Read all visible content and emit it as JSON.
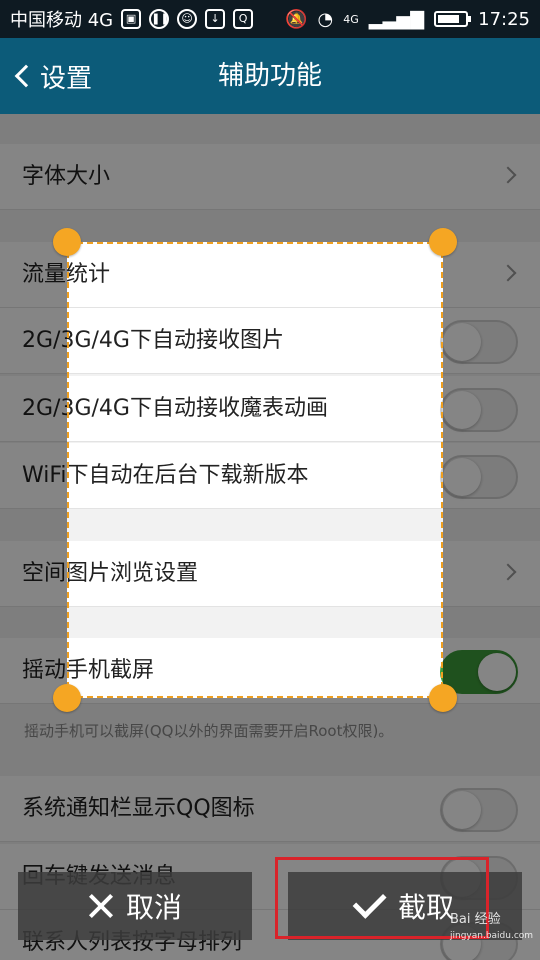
{
  "status_bar": {
    "carrier": "中国移动 4G",
    "signal": "4G",
    "time": "17:25",
    "battery_level": 0.8
  },
  "title_bar": {
    "back_label": "设置",
    "title": "辅助功能"
  },
  "settings": [
    {
      "label": "字体大小",
      "control": "arrow"
    },
    {
      "label": "流量统计",
      "control": "arrow"
    },
    {
      "label": "2G/3G/4G下自动接收图片",
      "control": "toggle",
      "on": false
    },
    {
      "label": "2G/3G/4G下自动接收魔表动画",
      "control": "toggle",
      "on": false
    },
    {
      "label": "WiFi下自动在后台下载新版本",
      "control": "toggle",
      "on": false
    },
    {
      "label": "空间图片浏览设置",
      "control": "arrow"
    },
    {
      "label": "摇动手机截屏",
      "control": "toggle",
      "on": true
    },
    {
      "label": "系统通知栏显示QQ图标",
      "control": "toggle",
      "on": false
    },
    {
      "label": "回车键发送消息",
      "control": "toggle",
      "on": false
    },
    {
      "label": "联系人列表按字母排列",
      "control": "toggle",
      "on": false
    }
  ],
  "shake_hint": "摇动手机可以截屏(QQ以外的界面需要开启Root权限)。",
  "actions": {
    "cancel_label": "取消",
    "confirm_label": "截取"
  },
  "watermark": {
    "text": "Bai 经验",
    "url": "jingyan.baidu.com"
  },
  "colors": {
    "title_bar": "#0c5b79",
    "handle": "#f5a623",
    "toggle_on": "#3d9c3a",
    "highlight": "#d9232a"
  }
}
